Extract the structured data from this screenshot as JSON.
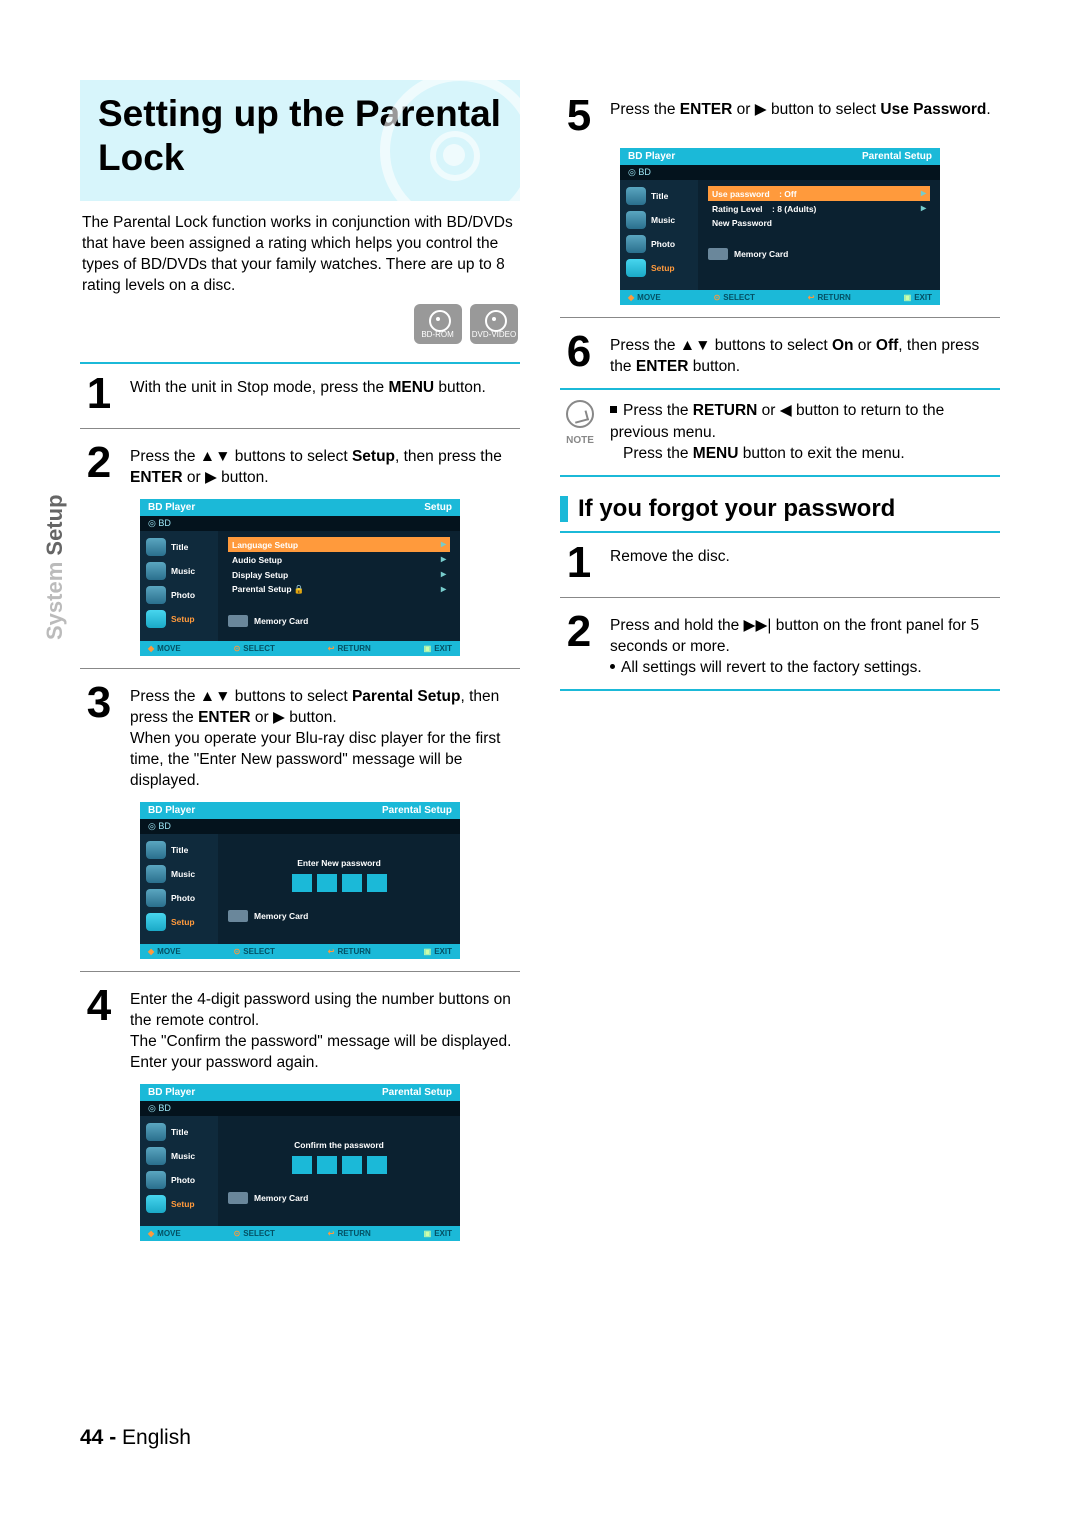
{
  "side_tab": {
    "light": "System ",
    "dark": "Setup"
  },
  "title": "Setting up the Parental Lock",
  "intro": "The Parental Lock function works in conjunction with BD/DVDs that have been assigned a rating which helps you control the types of BD/DVDs that your family watches. There are up to 8 rating levels on a disc.",
  "format_icons": [
    "BD-ROM",
    "DVD-VIDEO"
  ],
  "steps_left": {
    "1": {
      "pre": "With the unit in Stop mode, press the ",
      "b1": "MENU",
      "post": " button."
    },
    "2": {
      "pre": "Press the ▲▼ buttons to select ",
      "b1": "Setup",
      "mid": ", then press the ",
      "b2": "ENTER",
      "post": " or ▶ button."
    },
    "3": {
      "pre": "Press the ▲▼ buttons to select ",
      "b1": "Parental Setup",
      "mid": ", then press the ",
      "b2": "ENTER",
      "post": " or ▶ button.",
      "extra": "When you operate your Blu-ray disc player for the first time, the \"Enter New password\" message will be displayed."
    },
    "4": {
      "line1": "Enter the 4-digit password using the number buttons on the remote control.",
      "line2": "The \"Confirm the password\" message will be displayed. Enter your password again."
    }
  },
  "steps_right": {
    "5": {
      "pre": "Press the ",
      "b1": "ENTER",
      "mid": " or ▶ button to select ",
      "b2": "Use Password",
      "post": "."
    },
    "6": {
      "pre": "Press the ▲▼ buttons to select ",
      "b1": "On",
      "mid": " or ",
      "b2": "Off",
      "mid2": ", then press the ",
      "b3": "ENTER",
      "post": " button."
    }
  },
  "note": {
    "label": "NOTE",
    "line1_pre": "Press the ",
    "line1_b": "RETURN",
    "line1_post": " or ◀ button to return to the previous menu.",
    "line2_pre": "Press the ",
    "line2_b": "MENU",
    "line2_post": " button to exit the menu."
  },
  "subheading": "If you forgot your password",
  "forgot": {
    "1": "Remove the disc.",
    "2": "Press and hold the ▶▶| button on the front panel for 5 seconds or more.",
    "2b": "All settings will revert to the factory settings."
  },
  "osd": {
    "player": "BD Player",
    "bd": "BD",
    "side": {
      "title": "Title",
      "music": "Music",
      "photo": "Photo",
      "setup": "Setup"
    },
    "setup_title": "Setup",
    "parental_title": "Parental Setup",
    "menu_lang": "Language Setup",
    "menu_audio": "Audio Setup",
    "menu_disp": "Display Setup",
    "menu_par": "Parental Setup",
    "enter_pw": "Enter New password",
    "confirm_pw": "Confirm the password",
    "use_pw": "Use password",
    "use_pw_val": ": Off",
    "rating": "Rating Level",
    "rating_val": ": 8 (Adults)",
    "new_pw": "New Password",
    "memcard": "Memory Card",
    "foot": {
      "move": "MOVE",
      "select": "SELECT",
      "return": "RETURN",
      "exit": "EXIT"
    }
  },
  "page_number": {
    "num": "44 - ",
    "lang": "English"
  }
}
